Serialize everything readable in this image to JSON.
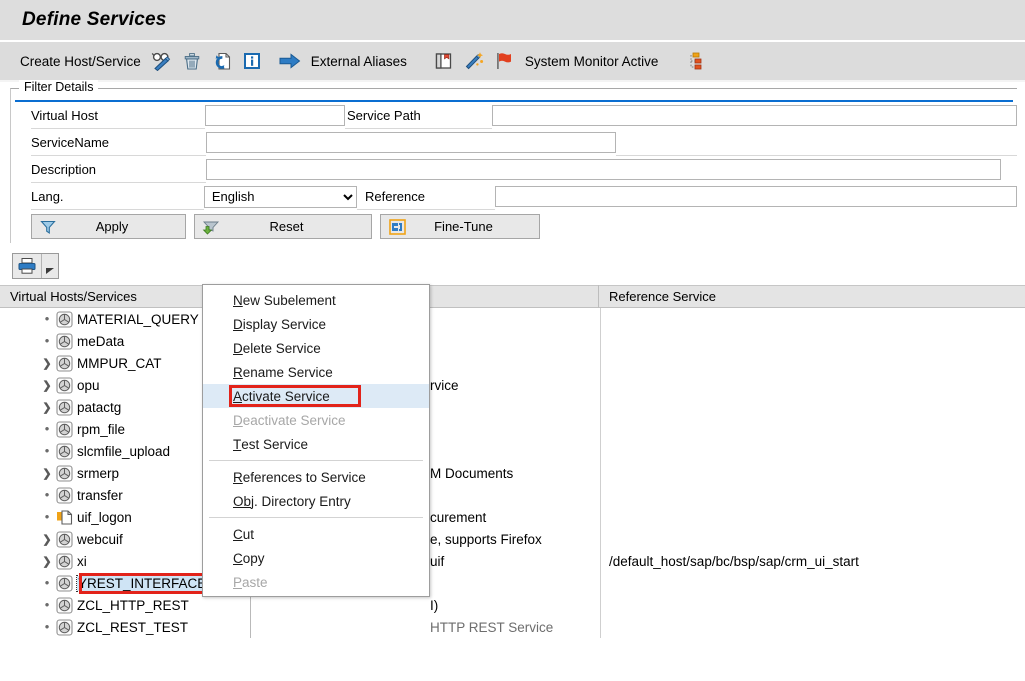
{
  "window": {
    "title": "Define Services"
  },
  "toolbar": {
    "create_label": "Create Host/Service",
    "external_aliases_label": "External Aliases",
    "system_monitor_label": "System Monitor Active",
    "icons": [
      "glasses-pencil-icon",
      "delete-trash-icon",
      "refresh-document-icon",
      "info-icon",
      "arrow-right-icon",
      "book-icon",
      "wizard-wand-icon",
      "red-flag-icon",
      "hierarchy-icon"
    ]
  },
  "filter": {
    "legend": "Filter Details",
    "virtual_host_label": "Virtual Host",
    "virtual_host_value": "",
    "service_path_label": "Service Path",
    "service_path_value": "",
    "service_name_label": "ServiceName",
    "service_name_value": "",
    "description_label": "Description",
    "description_value": "",
    "lang_label": "Lang.",
    "lang_value": "English",
    "lang_options": [
      "English"
    ],
    "reference_label": "Reference",
    "reference_value": "",
    "apply_label": "Apply",
    "reset_label": "Reset",
    "finetune_label": "Fine-Tune"
  },
  "print": {
    "icon": "printer-icon",
    "dropdown_icon": "triangle-down-icon"
  },
  "table": {
    "columns": [
      {
        "label": "Virtual Hosts/Services"
      },
      {
        "label": ""
      },
      {
        "label": "Reference Service"
      }
    ],
    "rows": [
      {
        "expander": "bullet",
        "icon": "service-globe-icon",
        "name": "MATERIAL_QUERY",
        "desc": "",
        "ref": ""
      },
      {
        "expander": "bullet",
        "icon": "service-globe-icon",
        "name": "meData",
        "desc": "",
        "ref": ""
      },
      {
        "expander": "arrow",
        "icon": "service-globe-icon",
        "name": "MMPUR_CAT",
        "desc": "",
        "ref": ""
      },
      {
        "expander": "arrow",
        "icon": "service-globe-icon",
        "name": "opu",
        "desc": "rvice",
        "ref": ""
      },
      {
        "expander": "arrow",
        "icon": "service-globe-icon",
        "name": "patactg",
        "desc": "",
        "ref": ""
      },
      {
        "expander": "bullet",
        "icon": "service-globe-icon",
        "name": "rpm_file",
        "desc": "",
        "ref": ""
      },
      {
        "expander": "bullet",
        "icon": "service-globe-icon",
        "name": "slcmfile_upload",
        "desc": "",
        "ref": ""
      },
      {
        "expander": "arrow",
        "icon": "service-globe-icon",
        "name": "srmerp",
        "desc": "M Documents",
        "ref": ""
      },
      {
        "expander": "bullet",
        "icon": "service-globe-icon",
        "name": "transfer",
        "desc": "",
        "ref": ""
      },
      {
        "expander": "bullet",
        "icon": "page-orange-icon",
        "name": "uif_logon",
        "desc": "curement",
        "ref": ""
      },
      {
        "expander": "arrow",
        "icon": "service-globe-icon",
        "name": "webcuif",
        "desc": "e, supports Firefox",
        "ref": ""
      },
      {
        "expander": "arrow",
        "icon": "service-globe-icon",
        "name": "xi",
        "desc": "uif",
        "ref": "/default_host/sap/bc/bsp/sap/crm_ui_start"
      },
      {
        "expander": "bullet",
        "icon": "service-globe-icon",
        "name": "YREST_INTERFACE",
        "desc": "",
        "ref": "",
        "selected": true
      },
      {
        "expander": "bullet",
        "icon": "service-globe-icon",
        "name": "ZCL_HTTP_REST",
        "desc": "I)",
        "ref": ""
      },
      {
        "expander": "bullet",
        "icon": "service-globe-icon",
        "name": "ZCL_REST_TEST",
        "desc": "HTTP REST Service",
        "ref": "",
        "desc_grey": true
      }
    ]
  },
  "context_menu": {
    "items": [
      {
        "accel": "N",
        "rest": "ew Subelement",
        "state": "normal"
      },
      {
        "accel": "D",
        "rest": "isplay Service",
        "state": "normal"
      },
      {
        "accel": "D",
        "rest": "elete Service",
        "state": "normal"
      },
      {
        "accel": "R",
        "rest": "ename Service",
        "state": "normal"
      },
      {
        "accel": "A",
        "rest": "ctivate Service",
        "state": "active"
      },
      {
        "accel": "D",
        "rest": "eactivate Service",
        "state": "disabled"
      },
      {
        "accel": "T",
        "rest": "est Service",
        "state": "normal"
      },
      {
        "separator": true
      },
      {
        "accel": "R",
        "rest": "eferences to Service",
        "state": "normal"
      },
      {
        "accel": "Ob",
        "rest": "j. Directory Entry",
        "state": "normal"
      },
      {
        "separator": true
      },
      {
        "accel": "C",
        "rest": "ut",
        "state": "normal"
      },
      {
        "accel": "C",
        "rest": "opy",
        "state": "normal"
      },
      {
        "accel": "P",
        "rest": "aste",
        "state": "disabled"
      }
    ]
  },
  "annotations": {
    "highlight_color": "#e2231a",
    "selection_color": "#cfe4f5",
    "accent_color": "#0a6ed1"
  }
}
